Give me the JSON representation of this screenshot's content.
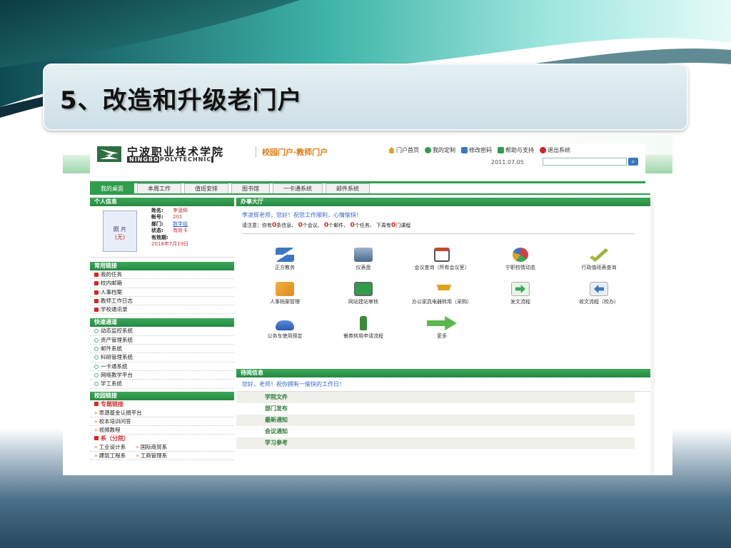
{
  "slide": {
    "title": "5、改造和升级老门户"
  },
  "portal": {
    "logo_cn": "宁波职业技术学院",
    "logo_en_bold": "NINGBO",
    "logo_en_rest": "POLYTECHNIC",
    "portal_title": "校园门户·教师门户",
    "top_links": [
      {
        "label": "门户首页",
        "icon": "home-icon",
        "color": "#e0a020"
      },
      {
        "label": "我的定制",
        "icon": "check-icon",
        "color": "#2f9d4c"
      },
      {
        "label": "修改密码",
        "icon": "key-icon",
        "color": "#3a78c2"
      },
      {
        "label": "帮助与支持",
        "icon": "help-icon",
        "color": "#2f9d4c"
      },
      {
        "label": "退出系统",
        "icon": "close-icon",
        "color": "#d22222"
      }
    ],
    "date": "2011.07.05",
    "tabs": [
      "我的桌面",
      "本周工作",
      "值班安排",
      "图书馆",
      "一卡通系统",
      "邮件系统"
    ],
    "personal": {
      "head": "个人信息",
      "photo": "照 片",
      "photo_sub": "(无)",
      "fields": [
        {
          "k": "姓名:",
          "v": "李凌辉"
        },
        {
          "k": "帐号:",
          "v": "201"
        },
        {
          "k": "部门:",
          "v": "数学组"
        },
        {
          "k": "状态:",
          "v": "有效卡"
        },
        {
          "k": "有效期:",
          "v": ""
        }
      ],
      "expiry": "2018年7月19日"
    },
    "common_links": {
      "head": "常用链接",
      "items": [
        "我的任务",
        "校内邮箱",
        "人事档案",
        "教师工作日志",
        "学校通讯录"
      ]
    },
    "quick_channels": {
      "head": "快速通道",
      "items": [
        "动态监控系统",
        "资产管理系统",
        "邮件系统",
        "科研管理系统",
        "一卡通系统",
        "网络教学平台",
        "学工系统"
      ]
    },
    "campus_links": {
      "head": "校园链接",
      "sub1": "专题链接",
      "sub1_items": [
        "思源基金认捐平台",
        "校本培训问答",
        "视频教程"
      ],
      "sub2": "系（分院）",
      "sub2_items": [
        "工业设计系",
        "国际商贸系",
        "建筑工程系",
        "工商管理系"
      ]
    },
    "office": {
      "head": "办事大厅",
      "greeting": "李凌辉老师，您好！祝您工作顺利，心情愉快！",
      "notice_prefix": "请注意：你有",
      "notice_items": [
        {
          "n": "0",
          "t": "条信息、"
        },
        {
          "n": "0",
          "t": "个会议、"
        },
        {
          "n": "0",
          "t": "个邮件、"
        },
        {
          "n": "0",
          "t": "个任务、"
        }
      ],
      "notice_week": "下周有",
      "notice_week_n": "0",
      "notice_week_t": "门课程",
      "apps": [
        {
          "label": "正方教务",
          "icon": "zf-logo-icon",
          "color": "#3a78c2"
        },
        {
          "label": "仪表盘",
          "icon": "monitor-icon",
          "color": "#4a6a8a"
        },
        {
          "label": "会议查询（所有会议室）",
          "icon": "calendar-icon",
          "color": "#c24a2a"
        },
        {
          "label": "宁职校情动态",
          "icon": "pie-chart-icon",
          "color": "#d04040"
        },
        {
          "label": "行政值班表查询",
          "icon": "pencil-check-icon",
          "color": "#6aa83a"
        },
        {
          "label": "人事档案管理",
          "icon": "folder-person-icon",
          "color": "#e08a20"
        },
        {
          "label": "网站建站审核",
          "icon": "screen-check-icon",
          "color": "#2f9d4c"
        },
        {
          "label": "办公家具电器转用（采购）",
          "icon": "cart-icon",
          "color": "#e0a020"
        },
        {
          "label": "发文流程",
          "icon": "arrow-right-icon",
          "color": "#3aa85a"
        },
        {
          "label": "收文流程（校办）",
          "icon": "arrow-left-icon",
          "color": "#3a78c2"
        },
        {
          "label": "公务车使用预定",
          "icon": "car-icon",
          "color": "#2a5ab0"
        },
        {
          "label": "餐券转用申请流程",
          "icon": "bottle-icon",
          "color": "#3a8a3a"
        },
        {
          "label": "更多",
          "icon": "big-arrow-right-icon",
          "color": "#5ab84a"
        }
      ]
    },
    "messages": {
      "head": "待阅信息",
      "greeting": "您好，老师！祝你拥有一愉快的工作日！",
      "rows": [
        "学院文件",
        "部门发布",
        "最新通知",
        "会议通知",
        "学习参考"
      ]
    }
  }
}
